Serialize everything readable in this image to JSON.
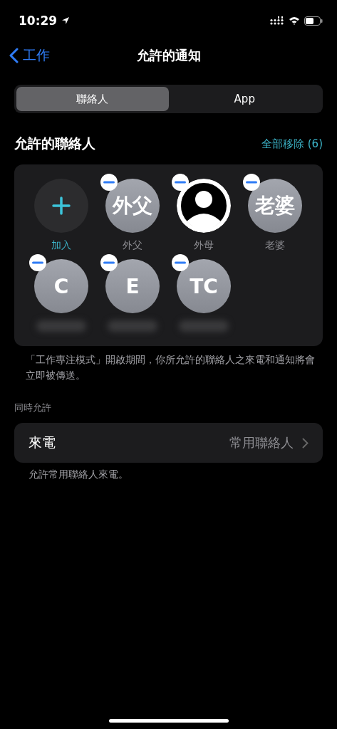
{
  "status_bar": {
    "time": "10:29"
  },
  "nav": {
    "back": "工作",
    "title": "允許的通知"
  },
  "segments": [
    {
      "label": "聯絡人",
      "selected": true
    },
    {
      "label": "App",
      "selected": false
    }
  ],
  "section": {
    "title": "允許的聯絡人",
    "action": "全部移除 (6)"
  },
  "contacts": [
    {
      "kind": "add",
      "label": "加入"
    },
    {
      "kind": "initials",
      "initials": "外父",
      "label": "外父",
      "removable": true
    },
    {
      "kind": "silhouette",
      "label": "外母",
      "removable": true
    },
    {
      "kind": "initials",
      "initials": "老婆",
      "label": "老婆",
      "removable": true
    },
    {
      "kind": "initials",
      "initials": "C",
      "name_hidden": true,
      "removable": true
    },
    {
      "kind": "initials",
      "initials": "E",
      "name_hidden": true,
      "removable": true
    },
    {
      "kind": "initials",
      "initials": "TC",
      "name_hidden": true,
      "removable": true
    }
  ],
  "contacts_note": "「工作專注模式」開啟期間，你所允許的聯絡人之來電和通知將會立即被傳送。",
  "also_allow": {
    "header": "同時允許",
    "rows": [
      {
        "label": "來電",
        "value": "常用聯絡人"
      }
    ],
    "note": "允許常用聯絡人來電。"
  }
}
